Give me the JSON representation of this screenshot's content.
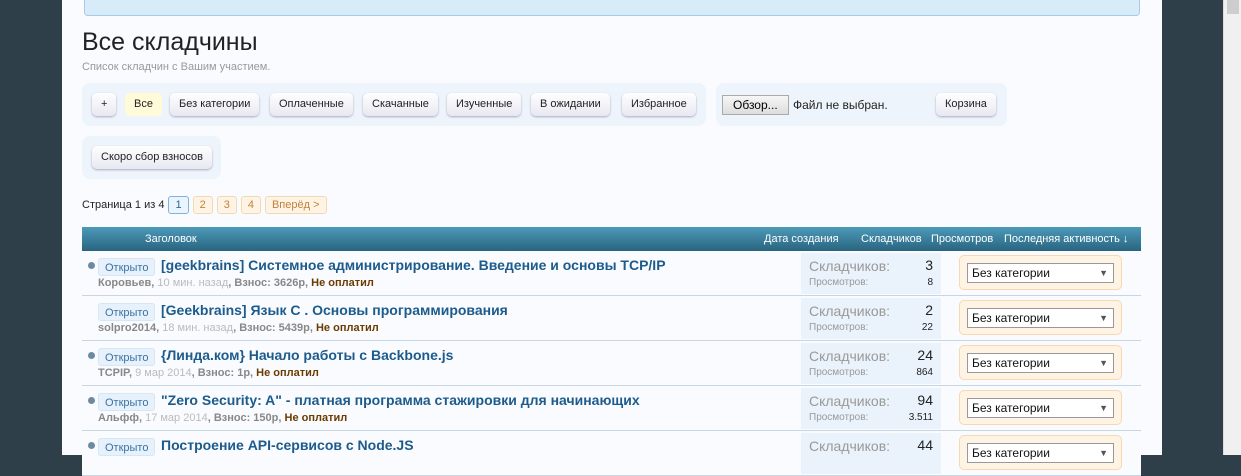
{
  "title": "Все складчины",
  "subtitle": "Список складчин с Вашим участием.",
  "filters": [
    "+",
    "Все",
    "Без категории",
    "Оплаченные",
    "Скачанные",
    "Изученные",
    "В ожидании",
    "Избранное"
  ],
  "filter2": "Скоро сбор взносов",
  "file": {
    "button": "Обзор...",
    "status": "Файл не выбран."
  },
  "cart": "Корзина",
  "pager": {
    "label": "Страница 1 из 4",
    "pages": [
      "1",
      "2",
      "3",
      "4"
    ],
    "next": "Вперёд >"
  },
  "headers": {
    "title": "Заголовок",
    "created": "Дата создания",
    "members": "Складчиков",
    "views": "Просмотров",
    "last": "Последняя активность ↓"
  },
  "labels": {
    "members": "Складчиков:",
    "views": "Просмотров:",
    "prefix": "Открыто"
  },
  "rows": [
    {
      "title": "[geekbrains] Системное администрирование. Введение и основы TCP/IP",
      "author": "Коровьев",
      "date": "10 мин. назад",
      "fee": "Взнос: 3626р",
      "status": "Не оплатил",
      "members": "3",
      "views": "8",
      "category": "Без категории"
    },
    {
      "title": "[Geekbrains] Язык С . Основы программирования",
      "author": "solpro2014",
      "date": "18 мин. назад",
      "fee": "Взнос: 5439р",
      "status": "Не оплатил",
      "members": "2",
      "views": "22",
      "category": "Без категории"
    },
    {
      "title": "{Линда.ком} Начало работы с Backbone.js",
      "author": "TCPIP",
      "date": "9 мар 2014",
      "fee": "Взнос: 1р",
      "status": "Не оплатил",
      "members": "24",
      "views": "864",
      "category": "Без категории"
    },
    {
      "title": "\"Zero Security: A\" - платная программа стажировки для начинающих",
      "author": "Альфф",
      "date": "17 мар 2014",
      "fee": "Взнос: 150р",
      "status": "Не оплатил",
      "members": "94",
      "views": "3.511",
      "category": "Без категории"
    },
    {
      "title": "Построение API-сервисов с Node.JS",
      "members": "44",
      "category": "Без категории"
    }
  ]
}
